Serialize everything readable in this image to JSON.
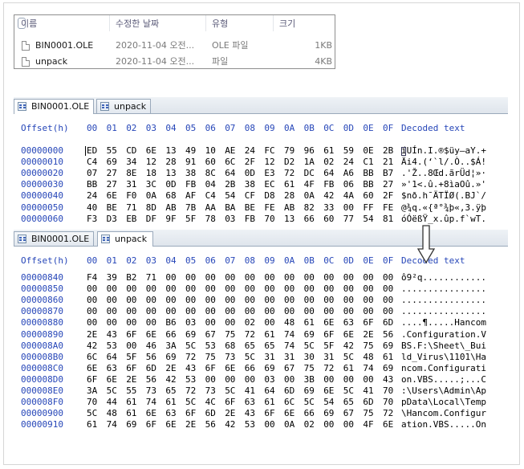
{
  "explorer": {
    "columns": [
      "이름",
      "수정한 날짜",
      "유형",
      "크기"
    ],
    "files": [
      {
        "name": "BIN0001.OLE",
        "date": "2020-11-04 오전...",
        "type": "OLE 파일",
        "size": "1KB"
      },
      {
        "name": "unpack",
        "date": "2020-11-04 오전...",
        "type": "파일",
        "size": "4KB"
      }
    ]
  },
  "top_panel": {
    "tabs": [
      "BIN0001.OLE",
      "unpack"
    ],
    "active_tab": 0,
    "header": {
      "offset": "Offset(h)",
      "cols": [
        "00",
        "01",
        "02",
        "03",
        "04",
        "05",
        "06",
        "07",
        "08",
        "09",
        "0A",
        "0B",
        "0C",
        "0D",
        "0E",
        "0F"
      ],
      "decoded": "Decoded text"
    },
    "rows": [
      {
        "off": "00000000",
        "bytes": [
          "ED",
          "55",
          "CD",
          "6E",
          "13",
          "49",
          "10",
          "AE",
          "24",
          "FC",
          "79",
          "96",
          "61",
          "59",
          "0E",
          "2B"
        ],
        "text": "íUÍn.I.®$üy–aY.+"
      },
      {
        "off": "00000010",
        "bytes": [
          "C4",
          "69",
          "34",
          "12",
          "28",
          "91",
          "60",
          "6C",
          "2F",
          "12",
          "D2",
          "1A",
          "02",
          "24",
          "C1",
          "21"
        ],
        "text": "Äi4.(‘`l/.Ò..$Á!"
      },
      {
        "off": "00000020",
        "bytes": [
          "07",
          "27",
          "8E",
          "18",
          "13",
          "38",
          "8C",
          "64",
          "0D",
          "E3",
          "72",
          "DC",
          "64",
          "A6",
          "BB",
          "B7"
        ],
        "text": ".'Ž..8Œd.ãrÜd¦»·"
      },
      {
        "off": "00000030",
        "bytes": [
          "BB",
          "27",
          "31",
          "3C",
          "0D",
          "FB",
          "04",
          "2B",
          "38",
          "EC",
          "61",
          "4F",
          "FB",
          "06",
          "BB",
          "27"
        ],
        "text": "»'1<.û.+8ìaOû.»'"
      },
      {
        "off": "00000040",
        "bytes": [
          "24",
          "6E",
          "F0",
          "0A",
          "68",
          "AF",
          "C4",
          "54",
          "CF",
          "D8",
          "28",
          "0A",
          "42",
          "4A",
          "60",
          "2F"
        ],
        "text": "$nð.h¯ÄTÏØ(.BJ`/"
      },
      {
        "off": "00000050",
        "bytes": [
          "40",
          "BE",
          "71",
          "8D",
          "AB",
          "7B",
          "AA",
          "BA",
          "BE",
          "FE",
          "AB",
          "82",
          "33",
          "00",
          "FF",
          "FE"
        ],
        "text": "@¾q.«{ª°¾þ«‚3.ÿþ"
      },
      {
        "off": "00000060",
        "bytes": [
          "F3",
          "D3",
          "EB",
          "DF",
          "9F",
          "5F",
          "78",
          "03",
          "FB",
          "70",
          "13",
          "66",
          "60",
          "77",
          "54",
          "81"
        ],
        "text": "óÓëßŸ_x.ûp.f`wT."
      }
    ]
  },
  "bottom_panel": {
    "tabs": [
      "BIN0001.OLE",
      "unpack"
    ],
    "active_tab": 1,
    "header": {
      "offset": "Offset(h)",
      "cols": [
        "00",
        "01",
        "02",
        "03",
        "04",
        "05",
        "06",
        "07",
        "08",
        "09",
        "0A",
        "0B",
        "0C",
        "0D",
        "0E",
        "0F"
      ],
      "decoded": "Decoded text"
    },
    "rows": [
      {
        "off": "00000840",
        "bytes": [
          "F4",
          "39",
          "B2",
          "71",
          "00",
          "00",
          "00",
          "00",
          "00",
          "00",
          "00",
          "00",
          "00",
          "00",
          "00",
          "00"
        ],
        "text": "ô9²q............"
      },
      {
        "off": "00000850",
        "bytes": [
          "00",
          "00",
          "00",
          "00",
          "00",
          "00",
          "00",
          "00",
          "00",
          "00",
          "00",
          "00",
          "00",
          "00",
          "00",
          "00"
        ],
        "text": "................"
      },
      {
        "off": "00000860",
        "bytes": [
          "00",
          "00",
          "00",
          "00",
          "00",
          "00",
          "00",
          "00",
          "00",
          "00",
          "00",
          "00",
          "00",
          "00",
          "00",
          "00"
        ],
        "text": "................"
      },
      {
        "off": "00000870",
        "bytes": [
          "00",
          "00",
          "00",
          "00",
          "00",
          "00",
          "00",
          "00",
          "00",
          "00",
          "00",
          "00",
          "00",
          "00",
          "00",
          "00"
        ],
        "text": "................"
      },
      {
        "off": "00000880",
        "bytes": [
          "00",
          "00",
          "00",
          "00",
          "B6",
          "03",
          "00",
          "00",
          "02",
          "00",
          "48",
          "61",
          "6E",
          "63",
          "6F",
          "6D"
        ],
        "text": "....¶.....Hancom"
      },
      {
        "off": "00000890",
        "bytes": [
          "2E",
          "43",
          "6F",
          "6E",
          "66",
          "69",
          "67",
          "75",
          "72",
          "61",
          "74",
          "69",
          "6F",
          "6E",
          "2E",
          "56"
        ],
        "text": ".Configuration.V"
      },
      {
        "off": "000008A0",
        "bytes": [
          "42",
          "53",
          "00",
          "46",
          "3A",
          "5C",
          "53",
          "68",
          "65",
          "65",
          "74",
          "5C",
          "5F",
          "42",
          "75",
          "69"
        ],
        "text": "BS.F:\\Sheet\\_Bui"
      },
      {
        "off": "000008B0",
        "bytes": [
          "6C",
          "64",
          "5F",
          "56",
          "69",
          "72",
          "75",
          "73",
          "5C",
          "31",
          "31",
          "30",
          "31",
          "5C",
          "48",
          "61"
        ],
        "text": "ld_Virus\\1101\\Ha"
      },
      {
        "off": "000008C0",
        "bytes": [
          "6E",
          "63",
          "6F",
          "6D",
          "2E",
          "43",
          "6F",
          "6E",
          "66",
          "69",
          "67",
          "75",
          "72",
          "61",
          "74",
          "69"
        ],
        "text": "ncom.Configurati"
      },
      {
        "off": "000008D0",
        "bytes": [
          "6F",
          "6E",
          "2E",
          "56",
          "42",
          "53",
          "00",
          "00",
          "00",
          "03",
          "00",
          "3B",
          "00",
          "00",
          "00",
          "43"
        ],
        "text": "on.VBS.....;...C"
      },
      {
        "off": "000008E0",
        "bytes": [
          "3A",
          "5C",
          "55",
          "73",
          "65",
          "72",
          "73",
          "5C",
          "41",
          "64",
          "6D",
          "69",
          "6E",
          "5C",
          "41",
          "70"
        ],
        "text": ":\\Users\\Admin\\Ap"
      },
      {
        "off": "000008F0",
        "bytes": [
          "70",
          "44",
          "61",
          "74",
          "61",
          "5C",
          "4C",
          "6F",
          "63",
          "61",
          "6C",
          "5C",
          "54",
          "65",
          "6D",
          "70"
        ],
        "text": "pData\\Local\\Temp"
      },
      {
        "off": "00000900",
        "bytes": [
          "5C",
          "48",
          "61",
          "6E",
          "63",
          "6F",
          "6D",
          "2E",
          "43",
          "6F",
          "6E",
          "66",
          "69",
          "67",
          "75",
          "72"
        ],
        "text": "\\Hancom.Configur"
      },
      {
        "off": "00000910",
        "bytes": [
          "61",
          "74",
          "69",
          "6F",
          "6E",
          "2E",
          "56",
          "42",
          "53",
          "00",
          "0A",
          "02",
          "00",
          "00",
          "4F",
          "6E"
        ],
        "text": "ation.VBS.....On"
      }
    ]
  }
}
